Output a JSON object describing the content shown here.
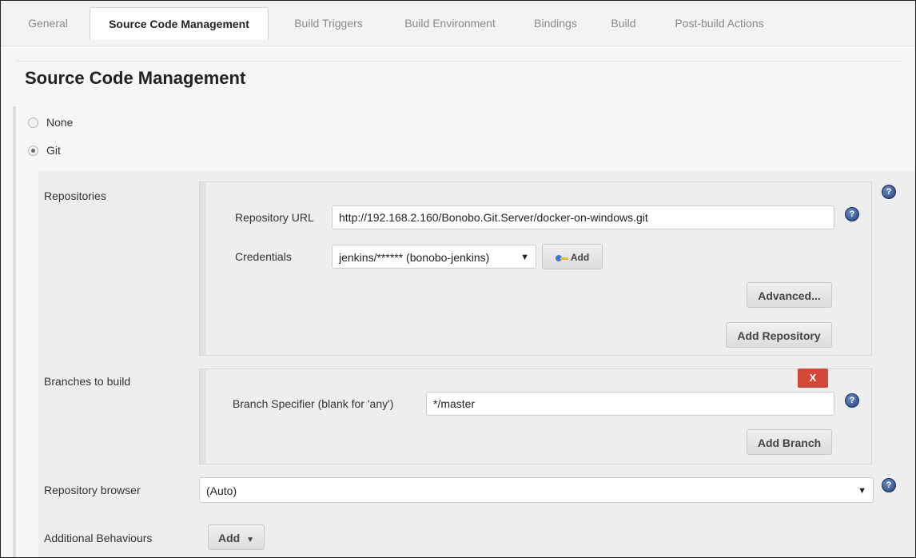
{
  "tabs": [
    {
      "label": "General"
    },
    {
      "label": "Source Code Management"
    },
    {
      "label": "Build Triggers"
    },
    {
      "label": "Build Environment"
    },
    {
      "label": "Bindings"
    },
    {
      "label": "Build"
    },
    {
      "label": "Post-build Actions"
    }
  ],
  "active_tab": "Source Code Management",
  "section_title": "Source Code Management",
  "scm_options": [
    {
      "label": "None",
      "checked": false
    },
    {
      "label": "Git",
      "checked": true
    }
  ],
  "repositories": {
    "label": "Repositories",
    "url_label": "Repository URL",
    "url_value": "http://192.168.2.160/Bonobo.Git.Server/docker-on-windows.git",
    "credentials_label": "Credentials",
    "credentials_value": "jenkins/****** (bonobo-jenkins)",
    "add_credentials_label": "Add",
    "advanced_label": "Advanced...",
    "add_repository_label": "Add Repository"
  },
  "branches": {
    "label": "Branches to build",
    "delete_label": "X",
    "specifier_label": "Branch Specifier (blank for 'any')",
    "specifier_value": "*/master",
    "add_branch_label": "Add Branch"
  },
  "repository_browser": {
    "label": "Repository browser",
    "value": "(Auto)"
  },
  "additional_behaviours": {
    "label": "Additional Behaviours",
    "add_label": "Add"
  },
  "icons": {
    "help": "question-mark-icon",
    "dropdown": "caret-down-icon",
    "credentials": "key-icon"
  },
  "colors": {
    "delete_button": "#d24939",
    "help_icon": "#1f3f7a"
  }
}
